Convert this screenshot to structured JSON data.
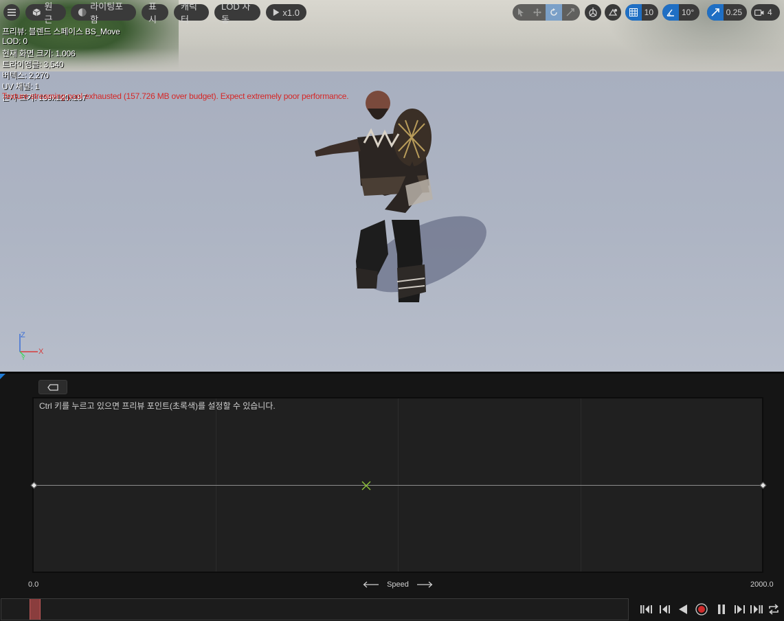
{
  "toolbar": {
    "menu_icon": "hamburger-icon",
    "perspective_label": "원근",
    "lighting_label": "라이팅포함",
    "show_label": "표시",
    "character_label": "캐릭터",
    "lod_label": "LOD 자동",
    "play_speed_label": "x1.0",
    "grid_snap_value": "10",
    "rotation_snap_value": "10°",
    "scale_snap_value": "0.25",
    "camera_speed_value": "4"
  },
  "overlay": {
    "preview_line": "프리뷰: 블렌드 스페이스 BS_Move",
    "lod_line": "LOD: 0",
    "screen_size_line": "현재 화면 크기: 1.006",
    "triangles_line": "트라이앵글: 3,540",
    "vertices_line": "버텍스: 2,270",
    "uv_line": "UV 채널: 1",
    "approx_size_line": "근사 크기: 139x120x187",
    "streaming_warning": "Texture streaming pool exhausted (157.726 MB over budget). Expect extremely poor performance."
  },
  "axis_gizmo": {
    "z": "Z",
    "x": "X",
    "y": "Y"
  },
  "blend_space": {
    "hint": "Ctrl 키를 누르고 있으면 프리뷰 포인트(초록색)를 설정할 수 있습니다.",
    "axis_min": "0.0",
    "axis_max": "2000.0",
    "axis_name": "Speed",
    "preview_point_color": "#8fc43a"
  },
  "timeline": {
    "scrub_color": "#8a3d3d",
    "record_color": "#d02a2a"
  }
}
